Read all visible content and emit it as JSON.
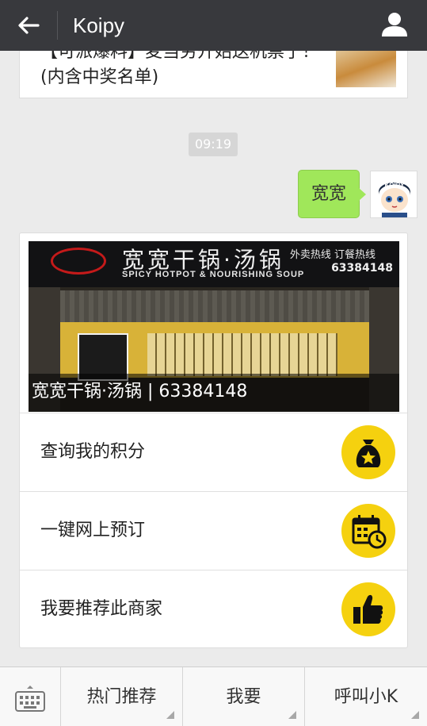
{
  "header": {
    "title": "Koipy"
  },
  "chat": {
    "article_text": "【可派爆料】麦当劳开始送机票了！(内含中奖名单)",
    "time": "09:19",
    "outgoing_message": "宽宽",
    "avatar_text": "KOIPY"
  },
  "merchant": {
    "sign_name": "宽宽干锅·汤锅",
    "sign_english": "SPICY HOTPOT & NOURISHING SOUP",
    "sign_phone_label": "外卖热线 订餐热线",
    "sign_phone": "63384148",
    "caption": "宽宽干锅·汤锅 | 63384148",
    "menu": [
      {
        "label": "查询我的积分",
        "icon": "money-bag-star-icon"
      },
      {
        "label": "一键网上预订",
        "icon": "calendar-clock-icon"
      },
      {
        "label": "我要推荐此商家",
        "icon": "thumbs-up-icon"
      }
    ],
    "icon_color": "#f5d10f"
  },
  "bottom_bar": {
    "tabs": [
      "热门推荐",
      "我要",
      "呼叫小K"
    ]
  }
}
